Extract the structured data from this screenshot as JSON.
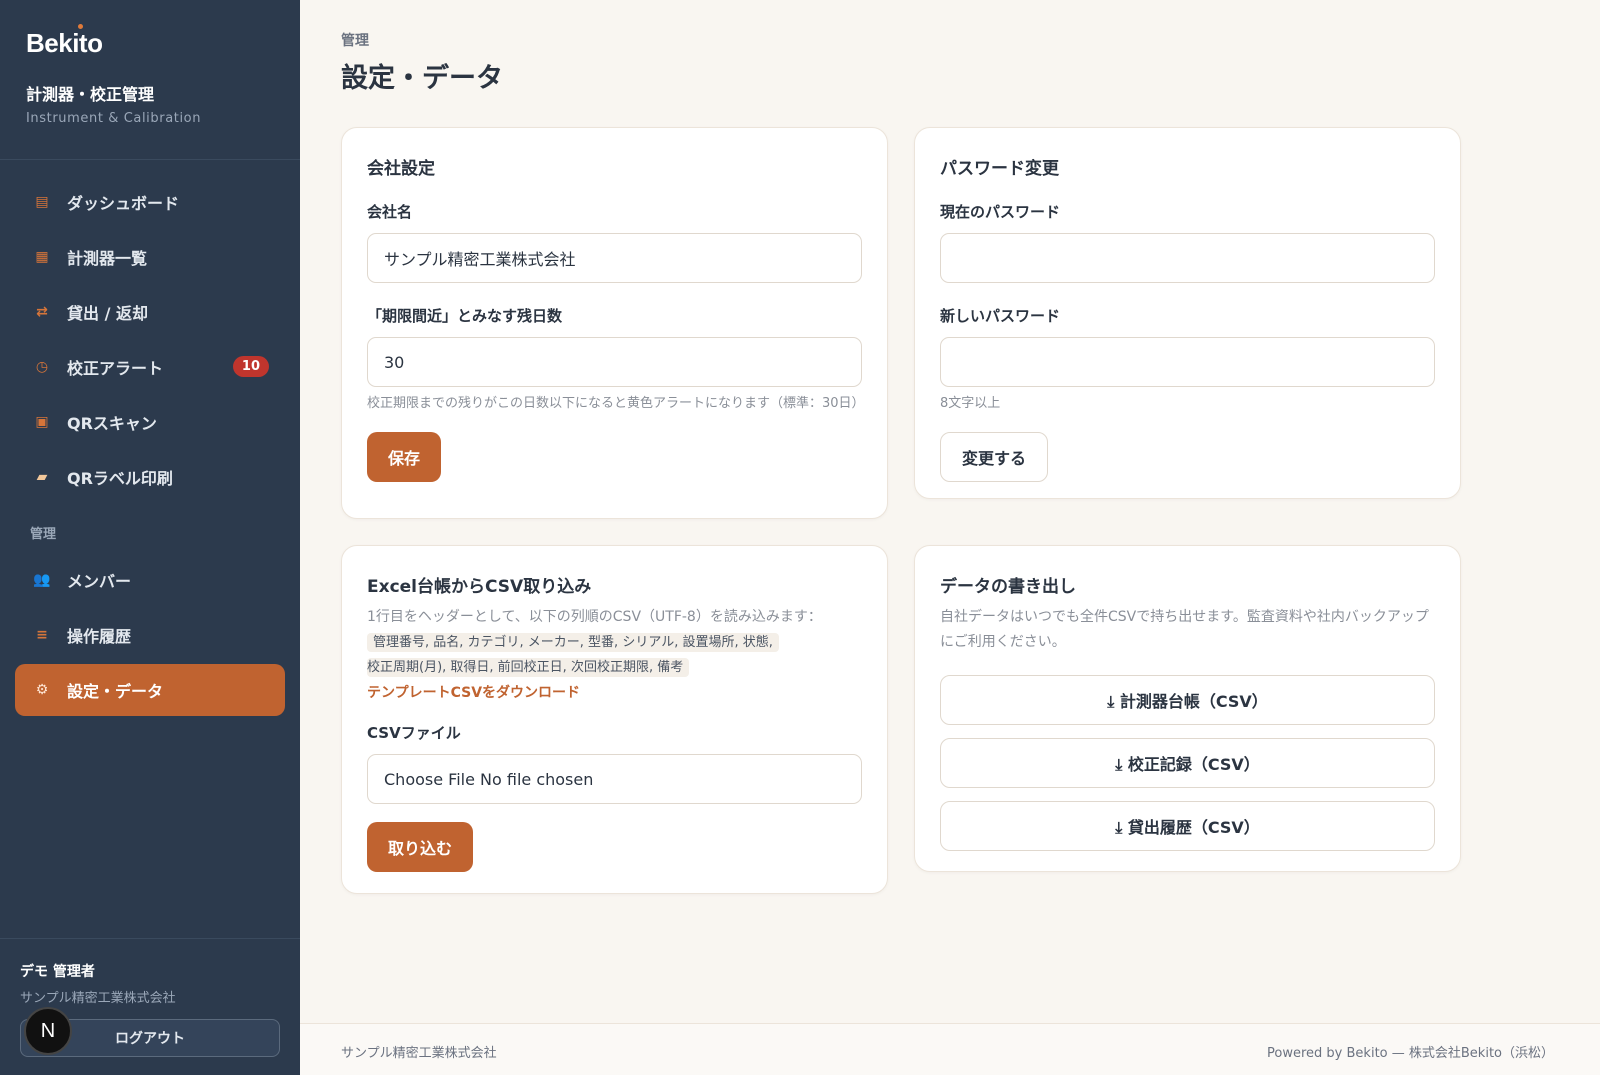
{
  "brand": {
    "logo": "Bekito",
    "title": "計測器・校正管理",
    "subtitle": "Instrument & Calibration"
  },
  "nav": {
    "items": [
      {
        "label": "ダッシュボード",
        "icon": "dashboard-icon"
      },
      {
        "label": "計測器一覧",
        "icon": "list-icon"
      },
      {
        "label": "貸出 / 返却",
        "icon": "swap-icon"
      },
      {
        "label": "校正アラート",
        "icon": "clock-icon",
        "badge": "10"
      },
      {
        "label": "QRスキャン",
        "icon": "scan-icon"
      },
      {
        "label": "QRラベル印刷",
        "icon": "label-icon"
      }
    ],
    "section_admin": "管理",
    "admin_items": [
      {
        "label": "メンバー",
        "icon": "members-icon"
      },
      {
        "label": "操作履歴",
        "icon": "history-icon"
      },
      {
        "label": "設定・データ",
        "icon": "gear-icon",
        "active": true
      }
    ]
  },
  "user": {
    "name": "デモ 管理者",
    "company": "サンプル精密工業株式会社",
    "logout": "ログアウト",
    "avatar_letter": "N"
  },
  "header": {
    "breadcrumb": "管理",
    "title": "設定・データ"
  },
  "company_settings": {
    "title": "会社設定",
    "name_label": "会社名",
    "name_value": "サンプル精密工業株式会社",
    "days_label": "「期限間近」とみなす残日数",
    "days_value": "30",
    "days_hint": "校正期限までの残りがこの日数以下になると黄色アラートになります（標準：30日）",
    "save": "保存"
  },
  "password": {
    "title": "パスワード変更",
    "current_label": "現在のパスワード",
    "new_label": "新しいパスワード",
    "hint": "8文字以上",
    "submit": "変更する"
  },
  "import": {
    "title": "Excel台帳からCSV取り込み",
    "desc": "1行目をヘッダーとして、以下の列順のCSV（UTF-8）を読み込みます：",
    "columns_line1": "管理番号, 品名, カテゴリ, メーカー, 型番, シリアル, 設置場所, 状態,",
    "columns_line2": "校正周期(月), 取得日, 前回校正日, 次回校正期限, 備考",
    "template_link": "テンプレートCSVをダウンロード",
    "file_label": "CSVファイル",
    "file_value": "Choose File  No file chosen",
    "submit": "取り込む"
  },
  "export": {
    "title": "データの書き出し",
    "desc": "自社データはいつでも全件CSVで持ち出せます。監査資料や社内バックアップにご利用ください。",
    "buttons": [
      "⤓ 計測器台帳（CSV）",
      "⤓ 校正記録（CSV）",
      "⤓ 貸出履歴（CSV）"
    ]
  },
  "footer": {
    "left": "サンプル精密工業株式会社",
    "right": "Powered by Bekito — 株式会社Bekito（浜松）"
  },
  "colors": {
    "sidebar": "#2c3a4d",
    "accent": "#c06330",
    "background": "#f9f6f1",
    "alert": "#c0352d"
  }
}
